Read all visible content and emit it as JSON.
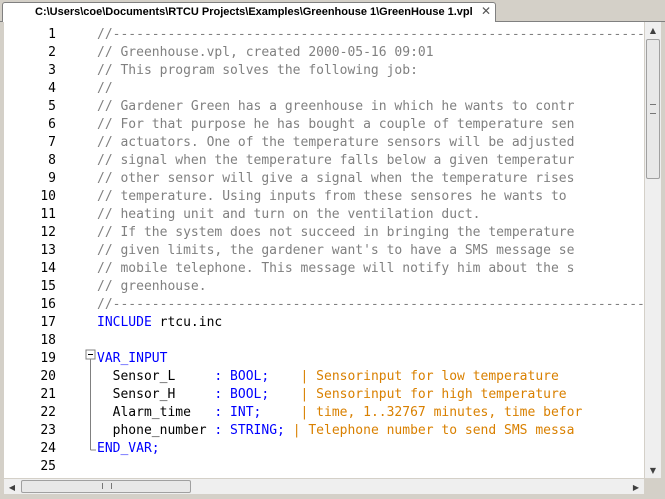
{
  "tab": {
    "title": "C:\\Users\\coe\\Documents\\RTCU Projects\\Examples\\Greenhouse 1\\GreenHouse 1.vpl",
    "close_glyph": "✕"
  },
  "lines": [
    {
      "n": "1",
      "parts": [
        {
          "t": "//---------------------------------------------------------------------------",
          "c": "comment"
        }
      ]
    },
    {
      "n": "2",
      "parts": [
        {
          "t": "// Greenhouse.vpl, created 2000-05-16 09:01",
          "c": "comment"
        }
      ]
    },
    {
      "n": "3",
      "parts": [
        {
          "t": "// This program solves the following job:",
          "c": "comment"
        }
      ]
    },
    {
      "n": "4",
      "parts": [
        {
          "t": "//",
          "c": "comment"
        }
      ]
    },
    {
      "n": "5",
      "parts": [
        {
          "t": "// Gardener Green has a greenhouse in which he wants to contr",
          "c": "comment"
        }
      ]
    },
    {
      "n": "6",
      "parts": [
        {
          "t": "// For that purpose he has bought a couple of temperature sen",
          "c": "comment"
        }
      ]
    },
    {
      "n": "7",
      "parts": [
        {
          "t": "// actuators. One of the temperature sensors will be adjusted",
          "c": "comment"
        }
      ]
    },
    {
      "n": "8",
      "parts": [
        {
          "t": "// signal when the temperature falls below a given temperatur",
          "c": "comment"
        }
      ]
    },
    {
      "n": "9",
      "parts": [
        {
          "t": "// other sensor will give a signal when the temperature rises",
          "c": "comment"
        }
      ]
    },
    {
      "n": "10",
      "parts": [
        {
          "t": "// temperature. Using inputs from these sensores he wants to",
          "c": "comment"
        }
      ]
    },
    {
      "n": "11",
      "parts": [
        {
          "t": "// heating unit and turn on the ventilation duct.",
          "c": "comment"
        }
      ]
    },
    {
      "n": "12",
      "parts": [
        {
          "t": "// If the system does not succeed in bringing the temperature",
          "c": "comment"
        }
      ]
    },
    {
      "n": "13",
      "parts": [
        {
          "t": "// given limits, the gardener want's to have a SMS message se",
          "c": "comment"
        }
      ]
    },
    {
      "n": "14",
      "parts": [
        {
          "t": "// mobile telephone. This message will notify him about the s",
          "c": "comment"
        }
      ]
    },
    {
      "n": "15",
      "parts": [
        {
          "t": "// greenhouse.",
          "c": "comment"
        }
      ]
    },
    {
      "n": "16",
      "parts": [
        {
          "t": "//---------------------------------------------------------------------------",
          "c": "comment"
        }
      ]
    },
    {
      "n": "17",
      "parts": [
        {
          "t": "INCLUDE",
          "c": "kw"
        },
        {
          "t": " rtcu.inc",
          "c": "plain"
        }
      ]
    },
    {
      "n": "18",
      "parts": []
    },
    {
      "n": "19",
      "parts": [
        {
          "t": "VAR_INPUT",
          "c": "kw"
        }
      ]
    },
    {
      "n": "20",
      "parts": [
        {
          "t": "  Sensor_L     ",
          "c": "plain"
        },
        {
          "t": ": BOOL;",
          "c": "kw"
        },
        {
          "t": "    ",
          "c": "plain"
        },
        {
          "t": "| Sensorinput for low temperature",
          "c": "str"
        }
      ]
    },
    {
      "n": "21",
      "parts": [
        {
          "t": "  Sensor_H     ",
          "c": "plain"
        },
        {
          "t": ": BOOL;",
          "c": "kw"
        },
        {
          "t": "    ",
          "c": "plain"
        },
        {
          "t": "| Sensorinput for high temperature",
          "c": "str"
        }
      ]
    },
    {
      "n": "22",
      "parts": [
        {
          "t": "  Alarm_time   ",
          "c": "plain"
        },
        {
          "t": ": INT;",
          "c": "kw"
        },
        {
          "t": "     ",
          "c": "plain"
        },
        {
          "t": "| time, 1..32767 minutes, time befor",
          "c": "str"
        }
      ]
    },
    {
      "n": "23",
      "parts": [
        {
          "t": "  phone_number ",
          "c": "plain"
        },
        {
          "t": ": STRING;",
          "c": "kw"
        },
        {
          "t": " ",
          "c": "plain"
        },
        {
          "t": "| Telephone number to send SMS messa",
          "c": "str"
        }
      ]
    },
    {
      "n": "24",
      "parts": [
        {
          "t": "END_VAR;",
          "c": "kw"
        }
      ]
    },
    {
      "n": "25",
      "parts": []
    }
  ],
  "scrollbars": {
    "up_glyph": "▲",
    "down_glyph": "▼",
    "left_glyph": "◀",
    "right_glyph": "▶"
  }
}
